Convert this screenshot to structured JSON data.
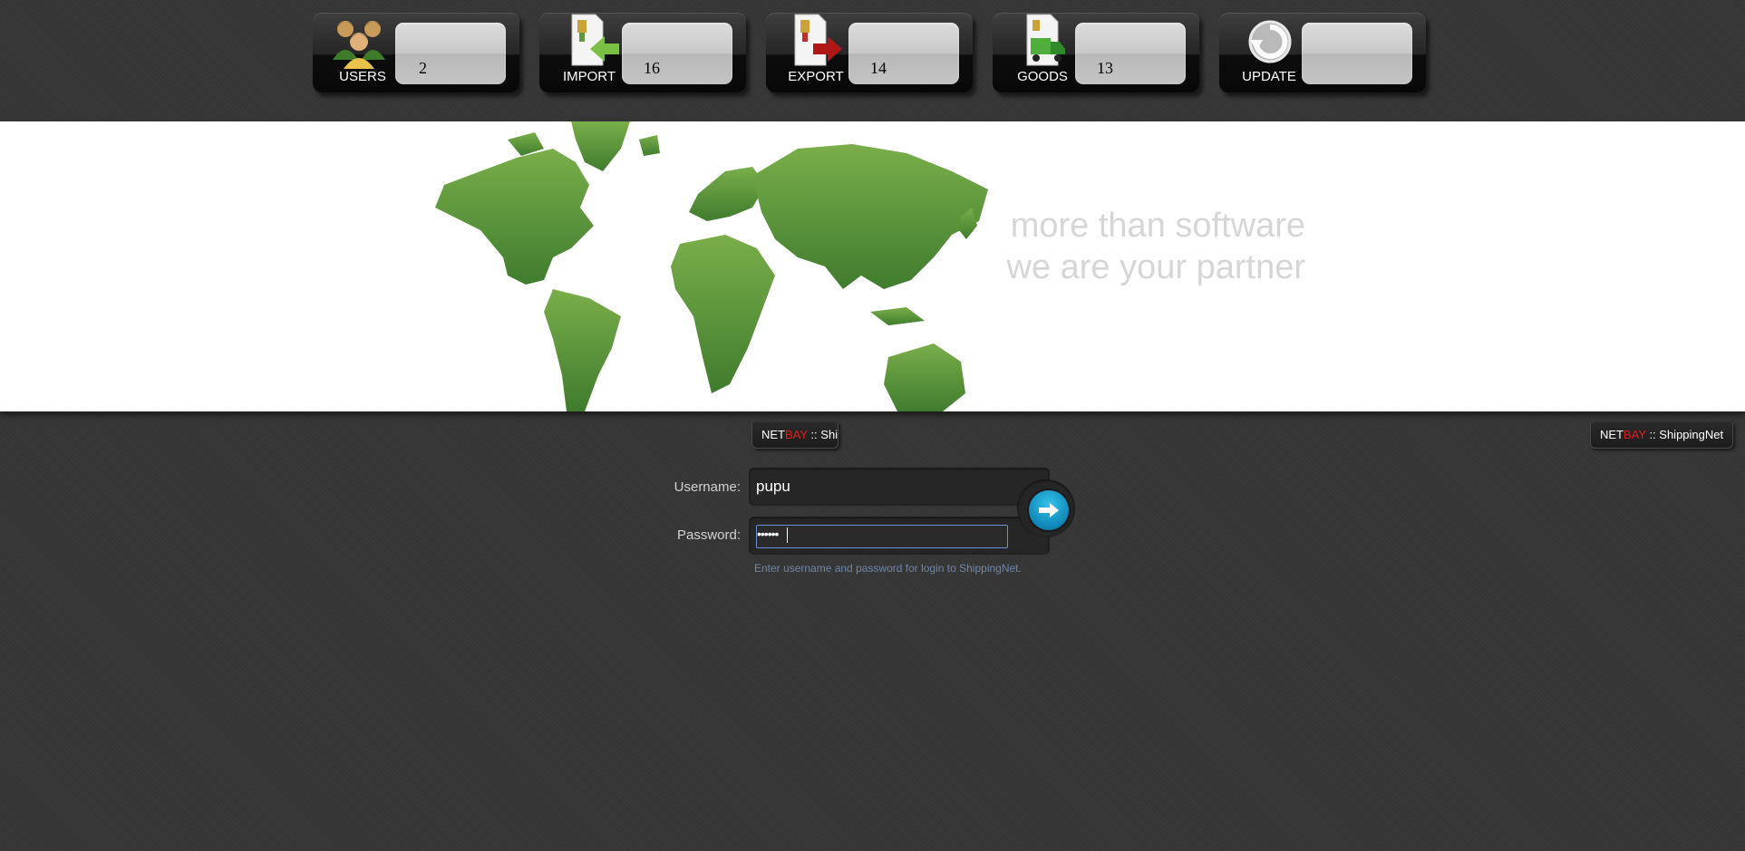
{
  "toolbar": {
    "tiles": [
      {
        "label": "USERS",
        "count": "2"
      },
      {
        "label": "IMPORT",
        "count": "16"
      },
      {
        "label": "EXPORT",
        "count": "14"
      },
      {
        "label": "GOODS",
        "count": "13"
      },
      {
        "label": "UPDATE",
        "count": ""
      }
    ]
  },
  "banner": {
    "tagline_line1": "more than software",
    "tagline_line2": "we are your partner"
  },
  "brand": {
    "net": "NET",
    "bay": "BAY",
    "suffix_short": " :: Ship",
    "suffix_full": " :: ShippingNet"
  },
  "login": {
    "username_label": "Username:",
    "username_value": "pupu",
    "password_label": "Password:",
    "password_mask": "••••••",
    "hint": "Enter username and password for login to ShippingNet."
  },
  "colors": {
    "background": "#363636",
    "map_green": "#5c9a3c",
    "brand_red": "#e31c1c",
    "login_button": "#1a9fd0"
  }
}
